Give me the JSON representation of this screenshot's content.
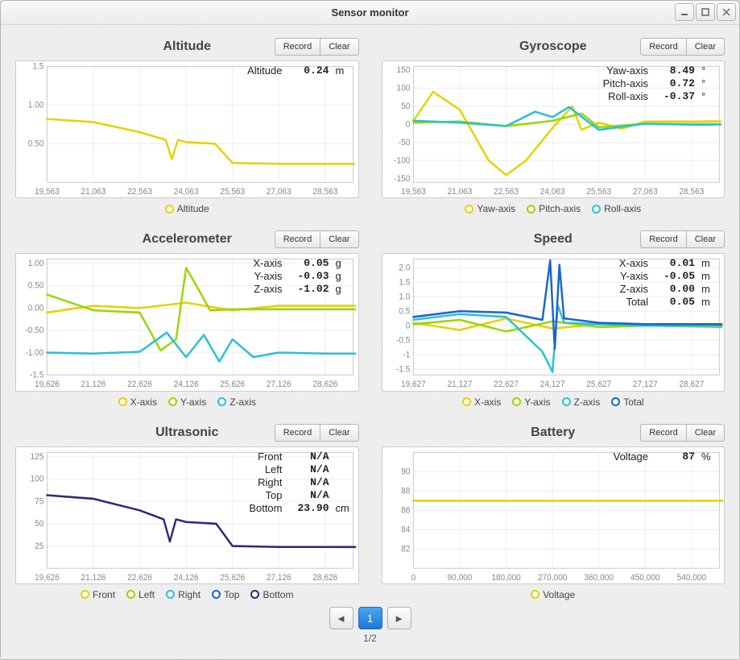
{
  "window": {
    "title": "Sensor monitor"
  },
  "buttons": {
    "record": "Record",
    "clear": "Clear"
  },
  "pager": {
    "page1": "1",
    "label": "1/2"
  },
  "panels": {
    "altitude": {
      "title": "Altitude",
      "readouts": [
        {
          "label": "Altitude",
          "value": "0.24",
          "unit": "m"
        }
      ],
      "legend": [
        "Altitude"
      ],
      "x_ticks": [
        "19,563",
        "21,063",
        "22,563",
        "24,063",
        "25,563",
        "27,063",
        "28,563"
      ],
      "y_ticks": [
        "0.50",
        "1.00",
        "1.5"
      ]
    },
    "gyroscope": {
      "title": "Gyroscope",
      "readouts": [
        {
          "label": "Yaw-axis",
          "value": "8.49",
          "unit": "°"
        },
        {
          "label": "Pitch-axis",
          "value": "0.72",
          "unit": "°"
        },
        {
          "label": "Roll-axis",
          "value": "-0.37",
          "unit": "°"
        }
      ],
      "legend": [
        "Yaw-axis",
        "Pitch-axis",
        "Roll-axis"
      ],
      "x_ticks": [
        "19,563",
        "21,063",
        "22,563",
        "24,063",
        "25,563",
        "27,063",
        "28,563"
      ],
      "y_ticks": [
        "-150",
        "-100",
        "-50",
        "0",
        "50",
        "100",
        "150"
      ]
    },
    "accelerometer": {
      "title": "Accelerometer",
      "readouts": [
        {
          "label": "X-axis",
          "value": "0.05",
          "unit": "g"
        },
        {
          "label": "Y-axis",
          "value": "-0.03",
          "unit": "g"
        },
        {
          "label": "Z-axis",
          "value": "-1.02",
          "unit": "g"
        }
      ],
      "legend": [
        "X-axis",
        "Y-axis",
        "Z-axis"
      ],
      "x_ticks": [
        "19,626",
        "21,126",
        "22,626",
        "24,126",
        "25,626",
        "27,126",
        "28,626"
      ],
      "y_ticks": [
        "-1.5",
        "-1.00",
        "-0.50",
        "0.00",
        "0.50",
        "1.00"
      ]
    },
    "speed": {
      "title": "Speed",
      "readouts": [
        {
          "label": "X-axis",
          "value": "0.01",
          "unit": "m"
        },
        {
          "label": "Y-axis",
          "value": "-0.05",
          "unit": "m"
        },
        {
          "label": "Z-axis",
          "value": "0.00",
          "unit": "m"
        },
        {
          "label": "Total",
          "value": "0.05",
          "unit": "m"
        }
      ],
      "legend": [
        "X-axis",
        "Y-axis",
        "Z-axis",
        "Total"
      ],
      "x_ticks": [
        "19,627",
        "21,127",
        "22,627",
        "24,127",
        "25,627",
        "27,127",
        "28,627"
      ],
      "y_ticks": [
        "-1.5",
        "-1",
        "-0.5",
        "0",
        "0.5",
        "1.0",
        "1.5",
        "2.0"
      ]
    },
    "ultrasonic": {
      "title": "Ultrasonic",
      "readouts": [
        {
          "label": "Front",
          "value": "N/A",
          "unit": ""
        },
        {
          "label": "Left",
          "value": "N/A",
          "unit": ""
        },
        {
          "label": "Right",
          "value": "N/A",
          "unit": ""
        },
        {
          "label": "Top",
          "value": "N/A",
          "unit": ""
        },
        {
          "label": "Bottom",
          "value": "23.90",
          "unit": "cm"
        }
      ],
      "legend": [
        "Front",
        "Left",
        "Right",
        "Top",
        "Bottom"
      ],
      "x_ticks": [
        "19,626",
        "21,126",
        "22,626",
        "24,126",
        "25,626",
        "27,126",
        "28,626"
      ],
      "y_ticks": [
        "25",
        "50",
        "75",
        "100",
        "125"
      ]
    },
    "battery": {
      "title": "Battery",
      "readouts": [
        {
          "label": "Voltage",
          "value": "87",
          "unit": "%"
        }
      ],
      "legend": [
        "Voltage"
      ],
      "x_ticks": [
        "0",
        "90,000",
        "180,000",
        "270,000",
        "360,000",
        "450,000",
        "540,000"
      ],
      "y_ticks": [
        "82",
        "84",
        "86",
        "88",
        "90"
      ]
    }
  },
  "chart_data": [
    {
      "type": "line",
      "title": "Altitude",
      "xlabel": "",
      "ylabel": "",
      "ylim": [
        0,
        1.5
      ],
      "x_ticks": [
        19563,
        21063,
        22563,
        24063,
        25563,
        27063,
        28563
      ],
      "series": [
        {
          "name": "Altitude",
          "color": "#e6d200",
          "x": [
            19563,
            21063,
            22563,
            23400,
            23600,
            23800,
            24063,
            25000,
            25563,
            27063,
            28563,
            29500
          ],
          "y": [
            0.82,
            0.78,
            0.65,
            0.55,
            0.3,
            0.55,
            0.52,
            0.5,
            0.25,
            0.24,
            0.24,
            0.24
          ]
        }
      ]
    },
    {
      "type": "line",
      "title": "Gyroscope",
      "ylim": [
        -160,
        160
      ],
      "x_ticks": [
        19563,
        21063,
        22563,
        24063,
        25563,
        27063,
        28563
      ],
      "series": [
        {
          "name": "Yaw-axis",
          "color": "#e6d200",
          "x": [
            19563,
            20200,
            21063,
            22000,
            22563,
            23200,
            24063,
            24700,
            25000,
            25563,
            26300,
            27063,
            28563,
            29500
          ],
          "y": [
            10,
            90,
            40,
            -100,
            -140,
            -100,
            -10,
            50,
            -15,
            5,
            -12,
            8,
            8,
            8.49
          ]
        },
        {
          "name": "Pitch-axis",
          "color": "#97d700",
          "x": [
            19563,
            21063,
            22563,
            24063,
            25000,
            25563,
            27063,
            28563,
            29500
          ],
          "y": [
            5,
            8,
            -5,
            10,
            30,
            -8,
            2,
            1,
            0.72
          ]
        },
        {
          "name": "Roll-axis",
          "color": "#29c0d6",
          "x": [
            19563,
            21063,
            22563,
            23500,
            24063,
            24600,
            25200,
            25563,
            27063,
            28563,
            29500
          ],
          "y": [
            10,
            5,
            -5,
            35,
            20,
            48,
            8,
            -15,
            2,
            -1,
            -0.37
          ]
        }
      ]
    },
    {
      "type": "line",
      "title": "Accelerometer",
      "ylim": [
        -1.5,
        1.1
      ],
      "x_ticks": [
        19626,
        21126,
        22626,
        24126,
        25626,
        27126,
        28626
      ],
      "series": [
        {
          "name": "X-axis",
          "color": "#e6d200",
          "x": [
            19626,
            21126,
            22626,
            24126,
            25626,
            27126,
            28626,
            29600
          ],
          "y": [
            -0.1,
            0.05,
            0.0,
            0.12,
            -0.05,
            0.05,
            0.05,
            0.05
          ]
        },
        {
          "name": "Y-axis",
          "color": "#97d700",
          "x": [
            19626,
            21126,
            22626,
            23300,
            23800,
            24126,
            24500,
            24900,
            25626,
            27126,
            28626,
            29600
          ],
          "y": [
            0.3,
            -0.05,
            -0.1,
            -0.95,
            -0.7,
            0.9,
            0.45,
            -0.05,
            -0.03,
            -0.03,
            -0.03,
            -0.03
          ]
        },
        {
          "name": "Z-axis",
          "color": "#29c0d6",
          "x": [
            19626,
            21126,
            22626,
            23500,
            24126,
            24700,
            25200,
            25626,
            26300,
            27126,
            28626,
            29600
          ],
          "y": [
            -1.0,
            -1.02,
            -0.98,
            -0.55,
            -1.1,
            -0.6,
            -1.2,
            -0.7,
            -1.1,
            -1.0,
            -1.02,
            -1.02
          ]
        }
      ]
    },
    {
      "type": "line",
      "title": "Speed",
      "ylim": [
        -1.7,
        2.3
      ],
      "x_ticks": [
        19627,
        21127,
        22627,
        24127,
        25627,
        27127,
        28627
      ],
      "series": [
        {
          "name": "X-axis",
          "color": "#e6d200",
          "x": [
            19627,
            21127,
            22627,
            24127,
            25627,
            27127,
            29600
          ],
          "y": [
            0.1,
            -0.15,
            0.25,
            -0.1,
            0.05,
            0.0,
            0.01
          ]
        },
        {
          "name": "Y-axis",
          "color": "#97d700",
          "x": [
            19627,
            21127,
            22627,
            24127,
            25627,
            27127,
            29600
          ],
          "y": [
            0.05,
            0.2,
            -0.2,
            0.15,
            -0.05,
            0.0,
            -0.05
          ]
        },
        {
          "name": "Z-axis",
          "color": "#29c0d6",
          "x": [
            19627,
            21127,
            22627,
            23800,
            24127,
            24300,
            24500,
            25627,
            27127,
            29600
          ],
          "y": [
            0.2,
            0.4,
            0.3,
            -0.9,
            -1.6,
            0.7,
            0.1,
            0.05,
            0.0,
            0.0
          ]
        },
        {
          "name": "Total",
          "color": "#1763d6",
          "x": [
            19627,
            21127,
            22627,
            23800,
            24050,
            24200,
            24350,
            24500,
            25627,
            27127,
            29600
          ],
          "y": [
            0.3,
            0.5,
            0.45,
            0.2,
            2.25,
            -0.8,
            2.1,
            0.25,
            0.1,
            0.05,
            0.05
          ]
        }
      ]
    },
    {
      "type": "line",
      "title": "Ultrasonic",
      "ylim": [
        0,
        130
      ],
      "x_ticks": [
        19626,
        21126,
        22626,
        24126,
        25626,
        27126,
        28626
      ],
      "series": [
        {
          "name": "Bottom",
          "color": "#2a2a7a",
          "x": [
            19626,
            21126,
            22626,
            23400,
            23600,
            23800,
            24126,
            25100,
            25626,
            27126,
            28626,
            29600
          ],
          "y": [
            82,
            78,
            65,
            55,
            30,
            55,
            52,
            50,
            25,
            24,
            24,
            23.9
          ]
        }
      ]
    },
    {
      "type": "line",
      "title": "Battery",
      "ylim": [
        80,
        92
      ],
      "x_ticks": [
        0,
        90000,
        180000,
        270000,
        360000,
        450000,
        540000
      ],
      "series": [
        {
          "name": "Voltage",
          "color": "#e6d200",
          "x": [
            0,
            600000
          ],
          "y": [
            87,
            87
          ]
        }
      ]
    }
  ]
}
